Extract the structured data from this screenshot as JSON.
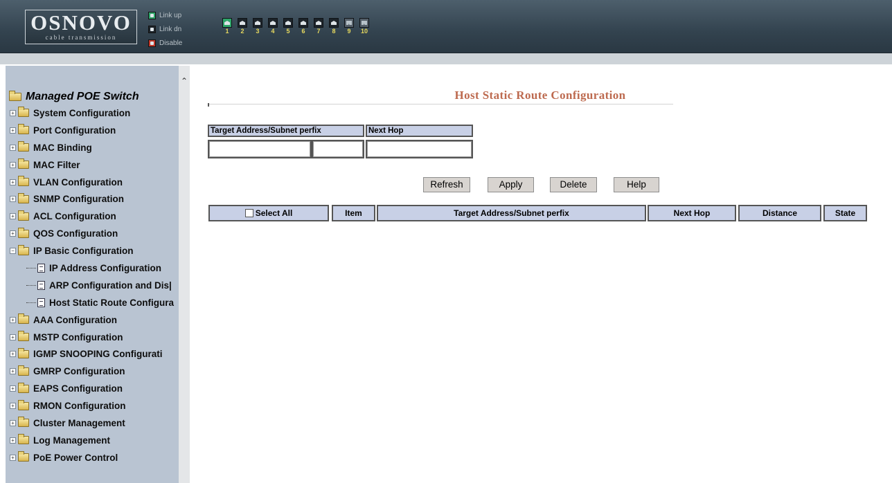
{
  "header": {
    "brand": "OSNOVO",
    "tagline": "cable transmission",
    "legend": [
      {
        "label": "Link up",
        "color": "#2fa66a"
      },
      {
        "label": "Link dn",
        "color": "#1d242a"
      },
      {
        "label": "Disable",
        "color": "#c0392b"
      }
    ],
    "ports": [
      {
        "num": "1",
        "state": "up"
      },
      {
        "num": "2",
        "state": "down"
      },
      {
        "num": "3",
        "state": "down"
      },
      {
        "num": "4",
        "state": "down"
      },
      {
        "num": "5",
        "state": "down"
      },
      {
        "num": "6",
        "state": "down"
      },
      {
        "num": "7",
        "state": "down"
      },
      {
        "num": "8",
        "state": "down"
      },
      {
        "num": "9",
        "state": "fiber"
      },
      {
        "num": "10",
        "state": "fiber"
      }
    ]
  },
  "sidebar": {
    "root": "Managed POE Switch",
    "items": [
      {
        "label": "System Configuration",
        "expanded": false
      },
      {
        "label": "Port Configuration",
        "expanded": false
      },
      {
        "label": "MAC Binding",
        "expanded": false
      },
      {
        "label": "MAC Filter",
        "expanded": false
      },
      {
        "label": "VLAN Configuration",
        "expanded": false
      },
      {
        "label": "SNMP Configuration",
        "expanded": false
      },
      {
        "label": "ACL Configuration",
        "expanded": false
      },
      {
        "label": "QOS Configuration",
        "expanded": false
      },
      {
        "label": "IP Basic Configuration",
        "expanded": true
      },
      {
        "label": "AAA Configuration",
        "expanded": false
      },
      {
        "label": "MSTP Configuration",
        "expanded": false
      },
      {
        "label": "IGMP SNOOPING Configurati",
        "expanded": false
      },
      {
        "label": "GMRP Configuration",
        "expanded": false
      },
      {
        "label": "EAPS Configuration",
        "expanded": false
      },
      {
        "label": "RMON Configuration",
        "expanded": false
      },
      {
        "label": "Cluster Management",
        "expanded": false
      },
      {
        "label": "Log Management",
        "expanded": false
      },
      {
        "label": "PoE Power Control",
        "expanded": false
      }
    ],
    "sub_items": [
      {
        "label": "IP Address Configuration"
      },
      {
        "label": "ARP Configuration and Dis|"
      },
      {
        "label": "Host Static Route Configura"
      }
    ]
  },
  "main": {
    "title": "Host Static Route Configuration",
    "form": {
      "target_label": "Target Address/Subnet perfix",
      "next_hop_label": "Next Hop",
      "target_address_value": "",
      "target_prefix_value": "",
      "next_hop_value": ""
    },
    "buttons": {
      "refresh": "Refresh",
      "apply": "Apply",
      "delete": "Delete",
      "help": "Help"
    },
    "table": {
      "select_all": "Select All",
      "columns": [
        "Item",
        "Target Address/Subnet perfix",
        "Next Hop",
        "Distance",
        "State"
      ],
      "rows": []
    }
  }
}
